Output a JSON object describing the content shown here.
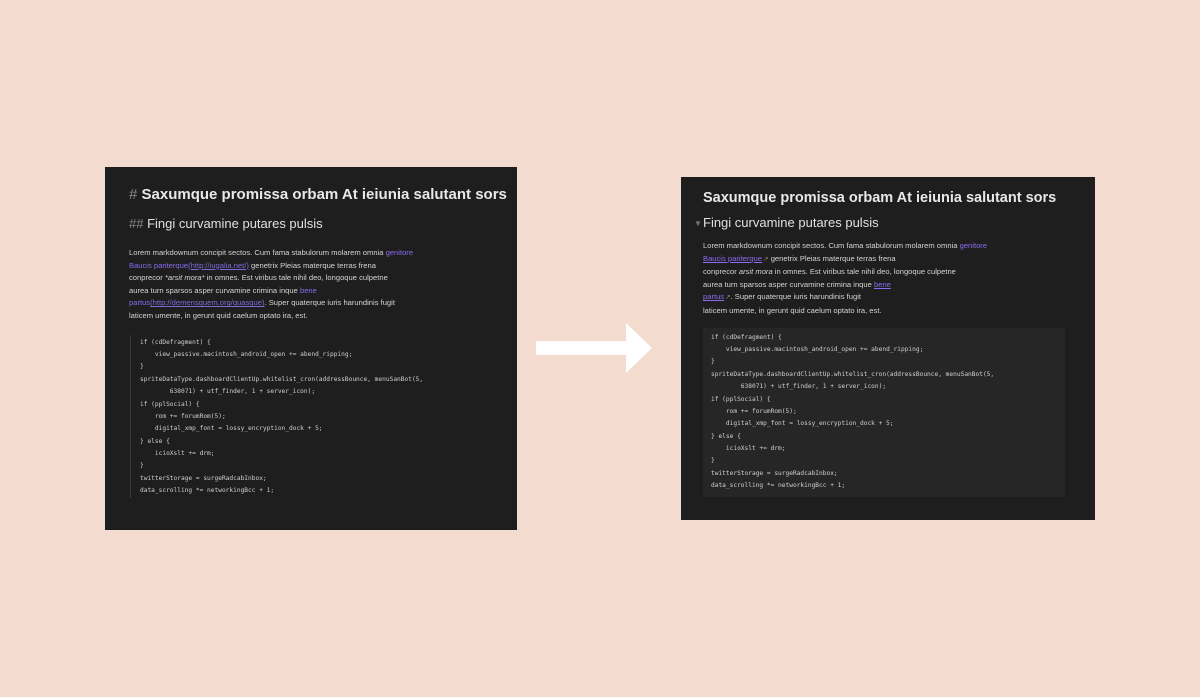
{
  "heading1": {
    "marker": "#",
    "text": "Saxumque promissa orbam At ieiunia salutant sors"
  },
  "heading2": {
    "marker": "##",
    "text": "Fingi curvamine putares pulsis"
  },
  "paragraph": {
    "t1": "Lorem markdownum concipit sectos. Cum fama stabulorum molarem omnia",
    "link1_a": "genitore",
    "link1_b": "Baucis pariterque",
    "link1_url": "(http://iugalia.net/)",
    "t2": "genetrix Pleias materque terras frena",
    "t3": "conprecor",
    "t3_em": "arsit mora",
    "t3_em_marked": "*arsit mora*",
    "t4": "in omnes. Est viribus tale nihil deo, longoque culpetne",
    "t5": "aurea turn sparsos asper curvamine crimina inque",
    "link2_a": "bene",
    "link2_b": "partus",
    "link2_url": "(http://demensquem.org/quasque)",
    "t6": ". Super quaterque iuris harundinis fugit",
    "t7": "laticem umente, in gerunt quid caelum optato ira, est."
  },
  "code_left": [
    "if (cdDefragment) {",
    "    view_passive.macintosh_android_open += abend_ripping;",
    "}",
    "spriteDataType.dashboardClientUp.whitelist_cron(addressBounce, menuSanBot(5,",
    "        638071) + utf_finder, 1 + server_icon);",
    "if (pplSocial) {",
    "    rom += forumRom(5);",
    "    digital_xmp_font = lossy_encryption_dock + 5;",
    "} else {",
    "    icioXslt += drm;",
    "}",
    "twitterStorage = surgeRadcabInbox;",
    "data_scrolling *= networkingBcc + 1;"
  ],
  "code_right": [
    "if (cdDefragment) {",
    "    view_passive.macintosh_android_open += abend_ripping;",
    "}",
    "spriteDataType.dashboardClientUp.whitelist_cron(addressBounce, menuSanBot(5,",
    "        638071) + utf_finder, 1 + server_icon);",
    "if (pplSocial) {",
    "    rom += forumRom(5);",
    "    digital_xmp_font = lossy_encryption_dock + 5;",
    "} else {",
    "    icioXslt += drm;",
    "}",
    "twitterStorage = surgeRadcabInbox;",
    "data_scrolling *= networkingBcc + 1;"
  ],
  "icons": {
    "fold": "chevron-down-icon",
    "external": "external-link-icon",
    "arrow": "arrow-right-icon"
  },
  "colors": {
    "background": "#f3dccf",
    "panel": "#1e1e1e",
    "code_block": "#262626",
    "link": "#8a6cf0",
    "arrow": "#ffffff"
  }
}
